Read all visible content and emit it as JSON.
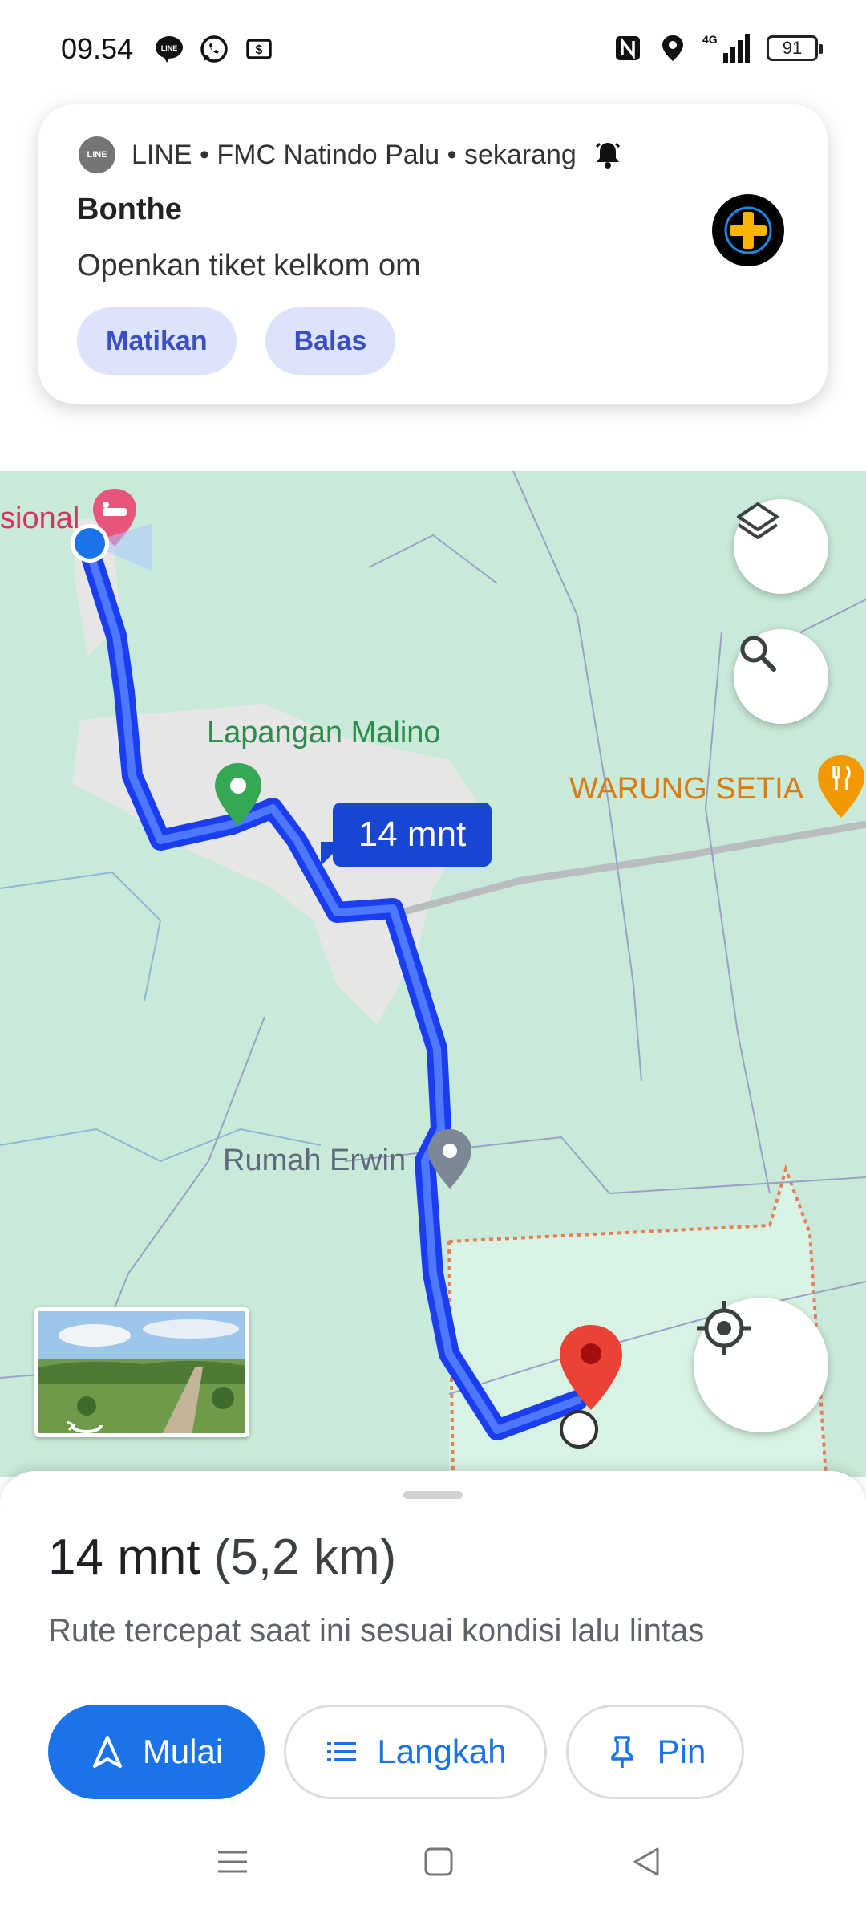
{
  "status_bar": {
    "time": "09.54",
    "battery": "91",
    "network": "4G",
    "left_icons": [
      "line-icon",
      "whatsapp-icon",
      "money-icon"
    ],
    "right_icons": [
      "nfc-icon",
      "location-icon",
      "signal-icon",
      "battery-icon"
    ]
  },
  "notification": {
    "header": "LINE • FMC Natindo Palu • sekarang",
    "app_badge": "LINE",
    "sender": "Bonthe",
    "message": "Openkan tiket kelkom om",
    "actions": [
      "Matikan",
      "Balas"
    ]
  },
  "map": {
    "labels": {
      "hotel": "sional",
      "lapangan": "Lapangan Malino",
      "warung": "WARUNG SETIA",
      "rumah": "Rumah Erwin"
    },
    "eta_bubble": "14 mnt",
    "colors": {
      "route": "#1a3df0",
      "land": "#c9ead8",
      "built": "#e8e8e8",
      "destination": "#ea4335",
      "poi_green": "#34a853",
      "poi_orange": "#f29900"
    }
  },
  "sheet": {
    "duration": "14 mnt",
    "distance": "(5,2 km)",
    "note": "Rute tercepat saat ini sesuai kondisi lalu lintas",
    "buttons": {
      "start": "Mulai",
      "steps": "Langkah",
      "pin": "Pin"
    },
    "accent": "#1a73e8"
  }
}
